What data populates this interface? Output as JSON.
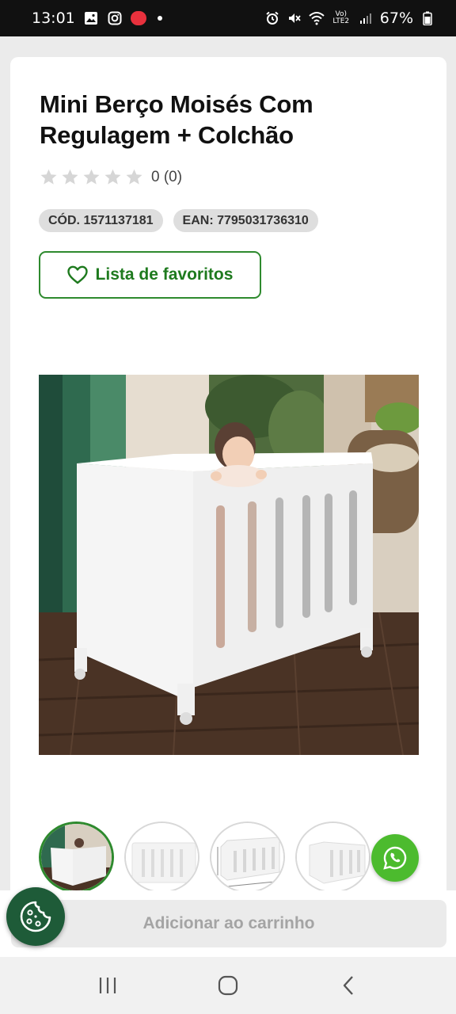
{
  "status_bar": {
    "time": "13:01",
    "battery": "67%",
    "network_label": "Vo) LTE2"
  },
  "product": {
    "title": "Mini Berço Moisés Com Regulagem + Colchão",
    "rating_value": 0,
    "rating_max": 5,
    "rating_text": "0 (0)",
    "code_tag": "CÓD. 1571137181",
    "ean_tag": "EAN: 7795031736310",
    "favorites_label": "Lista de favoritos",
    "thumbnail_count": 4,
    "active_thumbnail": 1
  },
  "cart": {
    "add_label": "Adicionar ao carrinho"
  },
  "icons": {
    "favorite": "heart-outline-icon",
    "whatsapp": "whatsapp-icon",
    "cookie": "cookie-icon",
    "nav_recent": "recent-apps-icon",
    "nav_home": "home-icon",
    "nav_back": "back-icon"
  },
  "colors": {
    "accent_green": "#2e8a2e",
    "whatsapp_green": "#4cbb2e",
    "cookie_bg": "#1e5b38",
    "tag_bg": "#dedede"
  }
}
